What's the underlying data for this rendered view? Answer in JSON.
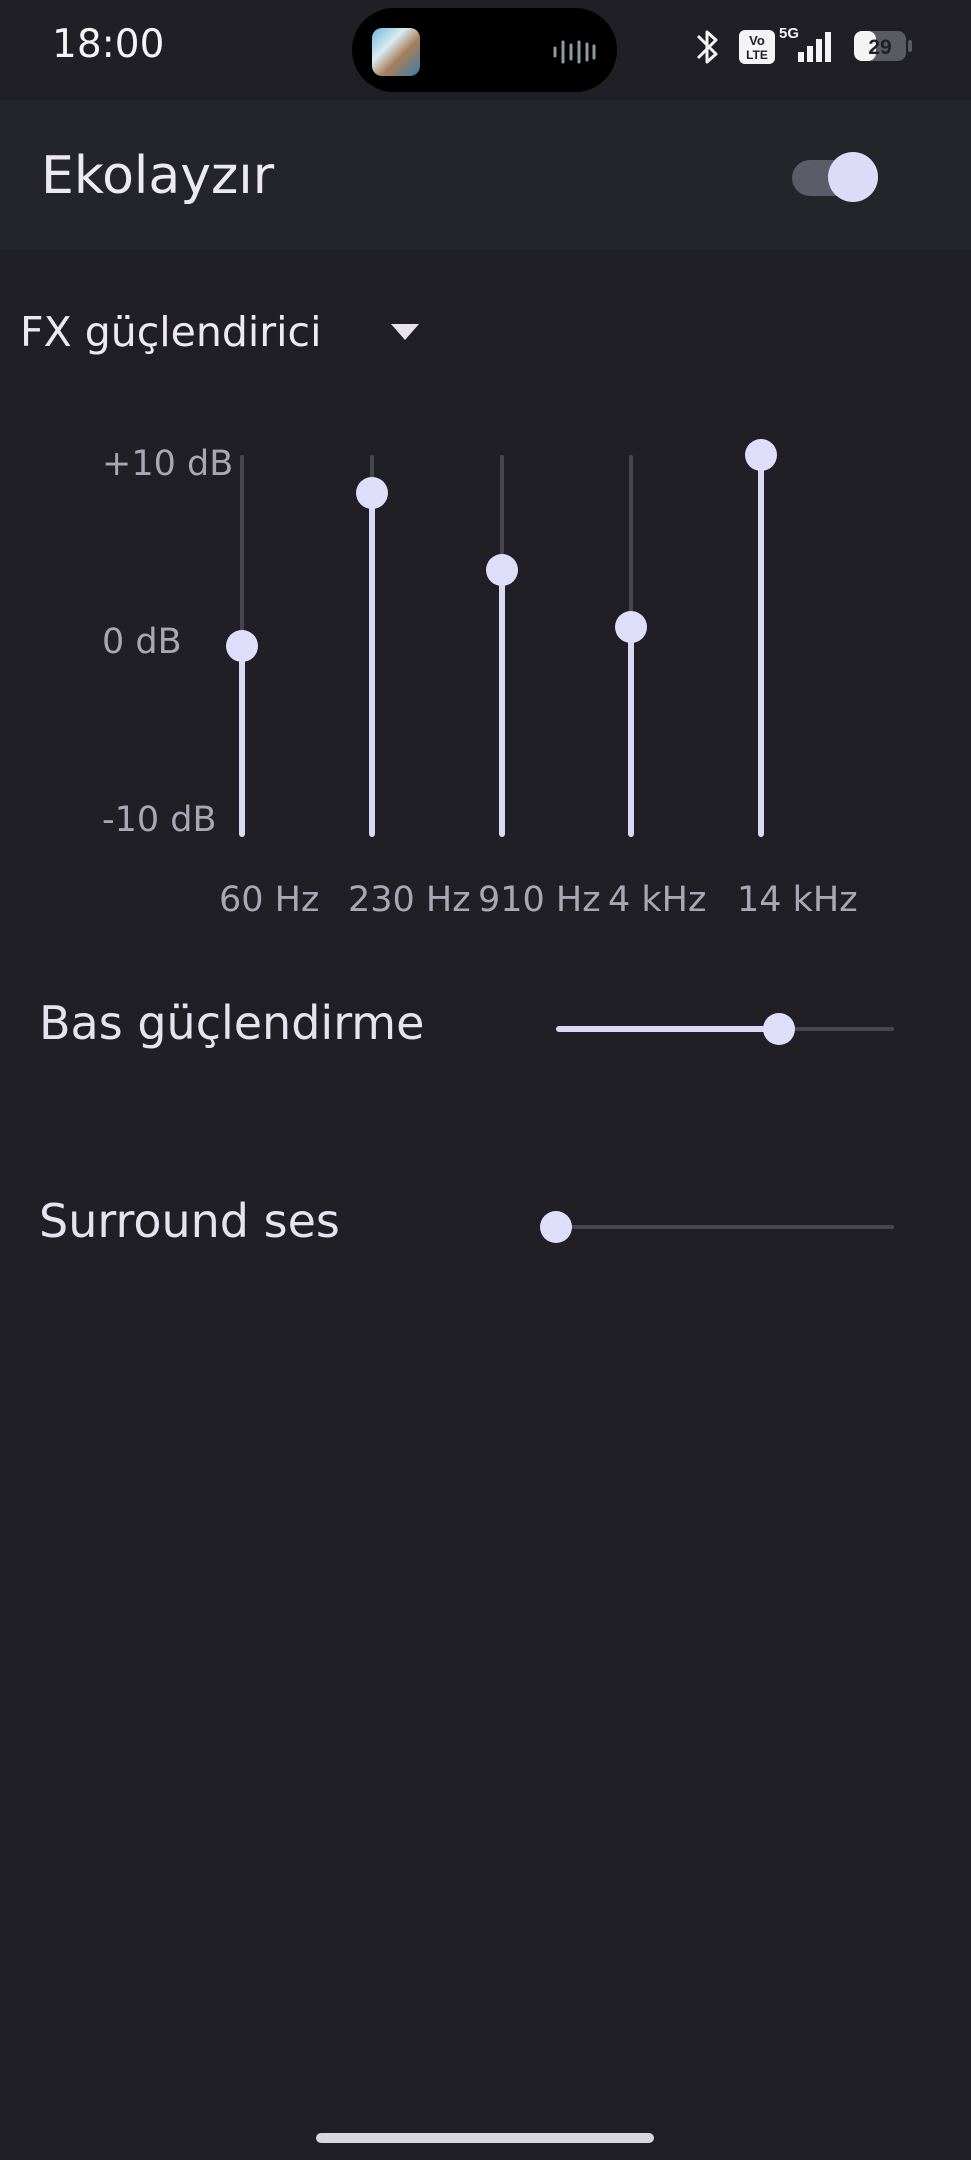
{
  "status_bar": {
    "time": "18:00",
    "network": "5G",
    "volte": "Vo LTE",
    "battery": "29",
    "icons": [
      "bluetooth-icon",
      "volte-icon",
      "signal-icon",
      "battery-icon"
    ]
  },
  "header": {
    "title": "Ekolayzır",
    "enabled": true
  },
  "preset": {
    "label": "FX güçlendirici"
  },
  "equalizer": {
    "db_labels": [
      "+10 dB",
      "0 dB",
      "-10 dB"
    ],
    "range_db": [
      -10,
      10
    ],
    "bands": [
      {
        "freq": "60 Hz",
        "gain_db": 0
      },
      {
        "freq": "230 Hz",
        "gain_db": 8
      },
      {
        "freq": "910 Hz",
        "gain_db": 4
      },
      {
        "freq": "4 kHz",
        "gain_db": 1
      },
      {
        "freq": "14 kHz",
        "gain_db": 10
      }
    ]
  },
  "bass_boost": {
    "label": "Bas güçlendirme",
    "level": 0.66
  },
  "surround": {
    "label": "Surround ses",
    "level": 0.0
  },
  "colors": {
    "background": "#1f1f25",
    "header_background": "#24242b",
    "accent": "#dcdcf8",
    "track": "#46464f"
  }
}
